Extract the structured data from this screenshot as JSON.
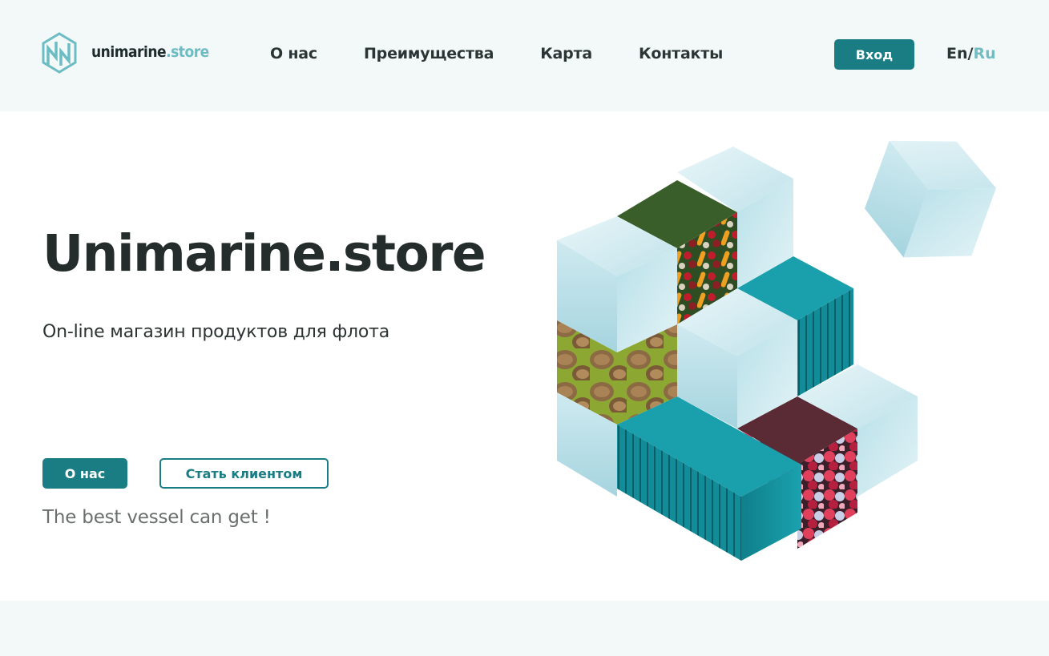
{
  "header": {
    "logo": {
      "name": "unimarine",
      "tld": ".store"
    },
    "nav": [
      {
        "label": "О нас"
      },
      {
        "label": "Преимущества"
      },
      {
        "label": "Карта"
      },
      {
        "label": "Контакты"
      }
    ],
    "login_label": "Вход",
    "lang": {
      "en": "En",
      "separator": "/",
      "ru": "Ru",
      "active": "Ru"
    }
  },
  "hero": {
    "title": "Unimarine.store",
    "subtitle": "On-line магазин продуктов для флота",
    "about_button": "О нас",
    "client_button": "Стать клиентом",
    "tagline": "The best vessel can get !"
  },
  "colors": {
    "accent": "#1a7d84",
    "accent_light": "#72bcc2",
    "header_bg": "#f3f8f9",
    "text_dark": "#242d2c"
  },
  "illustration": {
    "icon": "isometric-cubes-illustration",
    "items": [
      "ice-cube",
      "vegetables",
      "walnuts",
      "berries",
      "container"
    ]
  }
}
